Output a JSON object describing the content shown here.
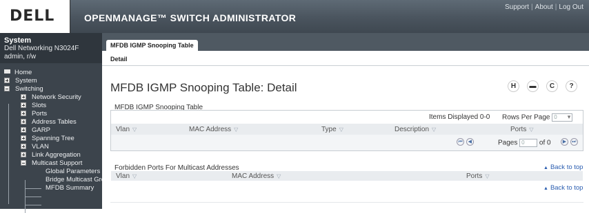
{
  "header": {
    "logo": "DELL",
    "title": "OPENMANAGE™ SWITCH ADMINISTRATOR",
    "links": [
      "Support",
      "About",
      "Log Out"
    ]
  },
  "sidebar": {
    "system_title": "System",
    "device": "Dell Networking N3024F",
    "user": "admin, r/w",
    "tree": [
      {
        "label": "Home"
      },
      {
        "label": "System"
      },
      {
        "label": "Switching"
      },
      {
        "label": "Network Security"
      },
      {
        "label": "Slots"
      },
      {
        "label": "Ports"
      },
      {
        "label": "Address Tables"
      },
      {
        "label": "GARP"
      },
      {
        "label": "Spanning Tree"
      },
      {
        "label": "VLAN"
      },
      {
        "label": "Link Aggregation"
      },
      {
        "label": "Multicast Support"
      },
      {
        "label": "Global Parameters"
      },
      {
        "label": "Bridge Multicast Gro"
      },
      {
        "label": "MFDB Summary"
      }
    ]
  },
  "tabs": {
    "active": "MFDB IGMP Snooping Table",
    "sub": "Detail"
  },
  "page": {
    "title": "MFDB IGMP Snooping Table: Detail",
    "icons": [
      "save-icon",
      "print-icon",
      "refresh-icon",
      "help-icon"
    ]
  },
  "table1": {
    "label": "MFDB IGMP Snooping Table",
    "items_displayed": "Items Displayed 0-0",
    "rows_per_page_label": "Rows Per Page",
    "rows_per_page_value": "0",
    "columns": [
      "Vlan",
      "MAC Address",
      "Type",
      "Description",
      "Ports"
    ],
    "pages_label": "Pages",
    "page_value": "0",
    "of_label": "of 0"
  },
  "table2": {
    "label": "Forbidden Ports For Multicast Addresses",
    "back_to_top": "Back to top",
    "columns": [
      "Vlan",
      "MAC Address",
      "Ports"
    ],
    "back_to_top_2": "Back to top"
  }
}
